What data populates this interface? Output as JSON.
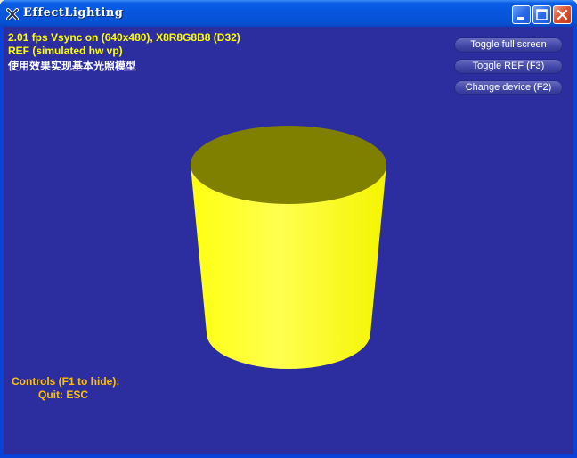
{
  "window": {
    "title": "EffectLighting"
  },
  "stats": {
    "frame_stats": "2.01 fps Vsync on (640x480), X8R8G8B8 (D32)",
    "device_stats": "REF (simulated hw vp)",
    "description": "使用效果实现基本光照模型"
  },
  "hud_buttons": [
    {
      "label": "Toggle full screen"
    },
    {
      "label": "Toggle REF (F3)"
    },
    {
      "label": "Change device (F2)"
    }
  ],
  "controls": {
    "header": "Controls (F1 to hide):",
    "quit": "Quit: ESC"
  },
  "colors": {
    "background": "#2C2EA0",
    "cylinder_side": "#FFFF00",
    "cylinder_top": "#808000",
    "stats_text": "#FFFF00",
    "controls_text": "#FFC000"
  },
  "icons": {
    "app": "app-icon",
    "minimize": "minimize-icon",
    "maximize": "maximize-icon",
    "close": "close-icon"
  }
}
